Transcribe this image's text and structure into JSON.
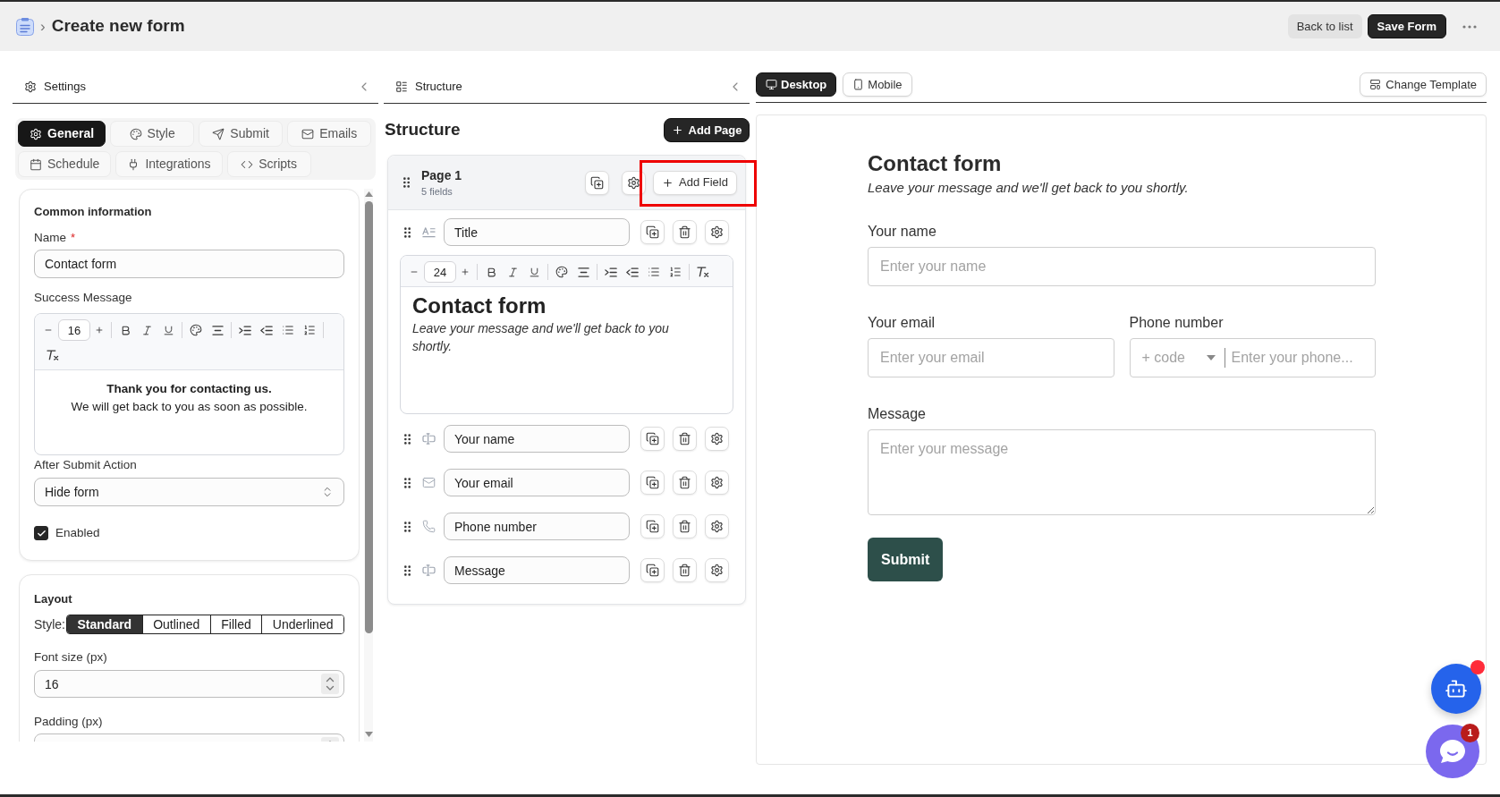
{
  "header": {
    "separator": "›",
    "title": "Create new form",
    "actions": [
      {
        "label": "Back to list",
        "kind": "secondary"
      },
      {
        "label": "Save Form",
        "kind": "primary"
      }
    ]
  },
  "settings_panel": {
    "title": "Settings",
    "tabs": [
      {
        "label": "General",
        "selected": true
      },
      {
        "label": "Style",
        "selected": false
      },
      {
        "label": "Submit",
        "selected": false
      },
      {
        "label": "Emails",
        "selected": false
      },
      {
        "label": "Schedule",
        "selected": false
      },
      {
        "label": "Integrations",
        "selected": false
      },
      {
        "label": "Scripts",
        "selected": false
      }
    ],
    "common_information": {
      "title": "Common information",
      "name": {
        "label": "Name",
        "required_mark": "*",
        "value": "Contact form"
      },
      "success_message": {
        "label": "Success Message",
        "font_size": "16",
        "lines": [
          {
            "text": "Thank you for contacting us.",
            "bold": true
          },
          {
            "text": "We will get back to you as soon as possible.",
            "bold": false
          }
        ]
      },
      "after_submit_action": {
        "label": "After Submit Action",
        "value": "Hide form"
      },
      "enabled": {
        "label": "Enabled",
        "checked": true
      }
    },
    "layout": {
      "title": "Layout",
      "style_label": "Style:",
      "style_options": [
        {
          "label": "Standard",
          "selected": true
        },
        {
          "label": "Outlined",
          "selected": false
        },
        {
          "label": "Filled",
          "selected": false
        },
        {
          "label": "Underlined",
          "selected": false
        }
      ],
      "font_size": {
        "label": "Font size (px)",
        "value": "16"
      },
      "padding": {
        "label": "Padding (px)"
      }
    }
  },
  "structure_panel": {
    "title": "Structure",
    "heading": "Structure",
    "add_page_label": "Add Page",
    "pages": [
      {
        "title": "Page 1",
        "count": "5 fields",
        "add_field_label": "Add Field",
        "fields": [
          {
            "kind": "title",
            "label": "Title",
            "editor": {
              "font_size": "24",
              "heading": "Contact form",
              "subheading": "Leave your message and we'll get back to you shortly."
            }
          },
          {
            "kind": "text",
            "label": "Your name"
          },
          {
            "kind": "email",
            "label": "Your email"
          },
          {
            "kind": "phone",
            "label": "Phone number"
          },
          {
            "kind": "textarea",
            "label": "Message"
          }
        ]
      }
    ]
  },
  "preview_panel": {
    "view_tabs": [
      {
        "label": "Desktop",
        "selected": true
      },
      {
        "label": "Mobile",
        "selected": false
      }
    ],
    "change_template_label": "Change Template",
    "form": {
      "title": "Contact form",
      "subtitle": "Leave your message and we'll get back to you shortly.",
      "rows": [
        {
          "fields": [
            {
              "kind": "text",
              "label": "Your name",
              "placeholder": "Enter your name"
            }
          ]
        },
        {
          "fields": [
            {
              "kind": "email",
              "label": "Your email",
              "placeholder": "Enter your email"
            },
            {
              "kind": "phone",
              "label": "Phone number",
              "code_placeholder": "+ code",
              "placeholder": "Enter your phone..."
            }
          ]
        },
        {
          "fields": [
            {
              "kind": "textarea",
              "label": "Message",
              "placeholder": "Enter your message"
            }
          ]
        }
      ],
      "submit_label": "Submit"
    }
  },
  "floating_buttons": {
    "assistant": {
      "notification": true
    },
    "chat": {
      "unread_count": "1"
    }
  }
}
